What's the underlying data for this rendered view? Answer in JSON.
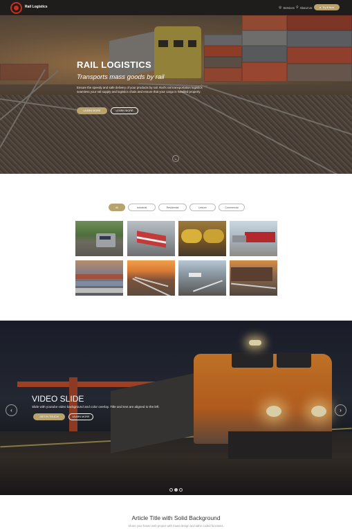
{
  "nav": {
    "brand": "Rail Logistics",
    "links": [
      {
        "label": "Services",
        "icon": "globe-icon"
      },
      {
        "label": "About Us",
        "icon": "search-icon"
      }
    ],
    "cta_label": "Try it Now",
    "cta_icon": "user-icon",
    "accent": "#b8a36f",
    "logo_color": "#c8301e"
  },
  "hero": {
    "title": "RAIL LOGISTICS",
    "subtitle": "Transports mass goods by rail",
    "text": "Ensure the speedy and safe delivery of your products by rail. Rail's rail transportation logistics seamless your rail supply and logistics chain and ensure that your cargo is handled properly.",
    "primary_button": "LEARN MORE",
    "secondary_button": "LEARN MORE",
    "scroll_icon": "chevron-down-icon"
  },
  "gallery": {
    "filters": [
      {
        "label": "All",
        "active": true
      },
      {
        "label": "Industrial",
        "active": false
      },
      {
        "label": "Residential",
        "active": false
      },
      {
        "label": "Leisure",
        "active": false
      },
      {
        "label": "Commercial",
        "active": false
      }
    ],
    "thumbnails": [
      "locomotive-green-hills",
      "red-train-station",
      "yellow-tank-cars",
      "red-freight-cars",
      "rail-yard-sunset",
      "tracks-sunset",
      "passenger-train-tracks",
      "freight-cars-sunset"
    ]
  },
  "video_slide": {
    "title": "VIDEO SLIDE",
    "text": "Slide with youtube video background and color overlay. Title and text are aligned to the left.",
    "primary_button": "GET IN TOUCH",
    "secondary_button": "LEARN MORE",
    "prev_icon": "chevron-left-icon",
    "next_icon": "chevron-right-icon",
    "dots": [
      false,
      true,
      false
    ]
  },
  "article": {
    "title": "Article Title with Solid Background",
    "subtitle": "Share your future web project with mass design and lathe coded functions."
  }
}
